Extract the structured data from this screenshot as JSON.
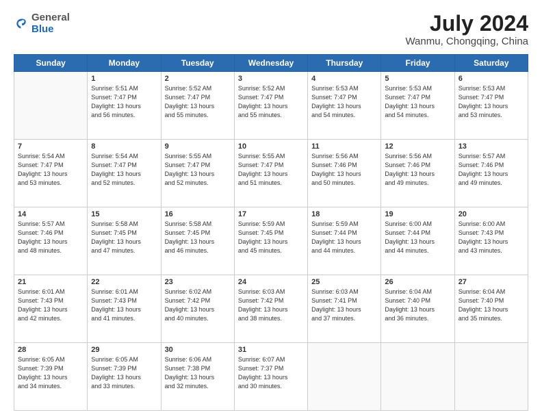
{
  "header": {
    "logo_general": "General",
    "logo_blue": "Blue",
    "month_year": "July 2024",
    "location": "Wanmu, Chongqing, China"
  },
  "days_of_week": [
    "Sunday",
    "Monday",
    "Tuesday",
    "Wednesday",
    "Thursday",
    "Friday",
    "Saturday"
  ],
  "weeks": [
    [
      {
        "day": "",
        "info": ""
      },
      {
        "day": "1",
        "info": "Sunrise: 5:51 AM\nSunset: 7:47 PM\nDaylight: 13 hours\nand 56 minutes."
      },
      {
        "day": "2",
        "info": "Sunrise: 5:52 AM\nSunset: 7:47 PM\nDaylight: 13 hours\nand 55 minutes."
      },
      {
        "day": "3",
        "info": "Sunrise: 5:52 AM\nSunset: 7:47 PM\nDaylight: 13 hours\nand 55 minutes."
      },
      {
        "day": "4",
        "info": "Sunrise: 5:53 AM\nSunset: 7:47 PM\nDaylight: 13 hours\nand 54 minutes."
      },
      {
        "day": "5",
        "info": "Sunrise: 5:53 AM\nSunset: 7:47 PM\nDaylight: 13 hours\nand 54 minutes."
      },
      {
        "day": "6",
        "info": "Sunrise: 5:53 AM\nSunset: 7:47 PM\nDaylight: 13 hours\nand 53 minutes."
      }
    ],
    [
      {
        "day": "7",
        "info": "Sunrise: 5:54 AM\nSunset: 7:47 PM\nDaylight: 13 hours\nand 53 minutes."
      },
      {
        "day": "8",
        "info": "Sunrise: 5:54 AM\nSunset: 7:47 PM\nDaylight: 13 hours\nand 52 minutes."
      },
      {
        "day": "9",
        "info": "Sunrise: 5:55 AM\nSunset: 7:47 PM\nDaylight: 13 hours\nand 52 minutes."
      },
      {
        "day": "10",
        "info": "Sunrise: 5:55 AM\nSunset: 7:47 PM\nDaylight: 13 hours\nand 51 minutes."
      },
      {
        "day": "11",
        "info": "Sunrise: 5:56 AM\nSunset: 7:46 PM\nDaylight: 13 hours\nand 50 minutes."
      },
      {
        "day": "12",
        "info": "Sunrise: 5:56 AM\nSunset: 7:46 PM\nDaylight: 13 hours\nand 49 minutes."
      },
      {
        "day": "13",
        "info": "Sunrise: 5:57 AM\nSunset: 7:46 PM\nDaylight: 13 hours\nand 49 minutes."
      }
    ],
    [
      {
        "day": "14",
        "info": "Sunrise: 5:57 AM\nSunset: 7:46 PM\nDaylight: 13 hours\nand 48 minutes."
      },
      {
        "day": "15",
        "info": "Sunrise: 5:58 AM\nSunset: 7:45 PM\nDaylight: 13 hours\nand 47 minutes."
      },
      {
        "day": "16",
        "info": "Sunrise: 5:58 AM\nSunset: 7:45 PM\nDaylight: 13 hours\nand 46 minutes."
      },
      {
        "day": "17",
        "info": "Sunrise: 5:59 AM\nSunset: 7:45 PM\nDaylight: 13 hours\nand 45 minutes."
      },
      {
        "day": "18",
        "info": "Sunrise: 5:59 AM\nSunset: 7:44 PM\nDaylight: 13 hours\nand 44 minutes."
      },
      {
        "day": "19",
        "info": "Sunrise: 6:00 AM\nSunset: 7:44 PM\nDaylight: 13 hours\nand 44 minutes."
      },
      {
        "day": "20",
        "info": "Sunrise: 6:00 AM\nSunset: 7:43 PM\nDaylight: 13 hours\nand 43 minutes."
      }
    ],
    [
      {
        "day": "21",
        "info": "Sunrise: 6:01 AM\nSunset: 7:43 PM\nDaylight: 13 hours\nand 42 minutes."
      },
      {
        "day": "22",
        "info": "Sunrise: 6:01 AM\nSunset: 7:43 PM\nDaylight: 13 hours\nand 41 minutes."
      },
      {
        "day": "23",
        "info": "Sunrise: 6:02 AM\nSunset: 7:42 PM\nDaylight: 13 hours\nand 40 minutes."
      },
      {
        "day": "24",
        "info": "Sunrise: 6:03 AM\nSunset: 7:42 PM\nDaylight: 13 hours\nand 38 minutes."
      },
      {
        "day": "25",
        "info": "Sunrise: 6:03 AM\nSunset: 7:41 PM\nDaylight: 13 hours\nand 37 minutes."
      },
      {
        "day": "26",
        "info": "Sunrise: 6:04 AM\nSunset: 7:40 PM\nDaylight: 13 hours\nand 36 minutes."
      },
      {
        "day": "27",
        "info": "Sunrise: 6:04 AM\nSunset: 7:40 PM\nDaylight: 13 hours\nand 35 minutes."
      }
    ],
    [
      {
        "day": "28",
        "info": "Sunrise: 6:05 AM\nSunset: 7:39 PM\nDaylight: 13 hours\nand 34 minutes."
      },
      {
        "day": "29",
        "info": "Sunrise: 6:05 AM\nSunset: 7:39 PM\nDaylight: 13 hours\nand 33 minutes."
      },
      {
        "day": "30",
        "info": "Sunrise: 6:06 AM\nSunset: 7:38 PM\nDaylight: 13 hours\nand 32 minutes."
      },
      {
        "day": "31",
        "info": "Sunrise: 6:07 AM\nSunset: 7:37 PM\nDaylight: 13 hours\nand 30 minutes."
      },
      {
        "day": "",
        "info": ""
      },
      {
        "day": "",
        "info": ""
      },
      {
        "day": "",
        "info": ""
      }
    ]
  ]
}
